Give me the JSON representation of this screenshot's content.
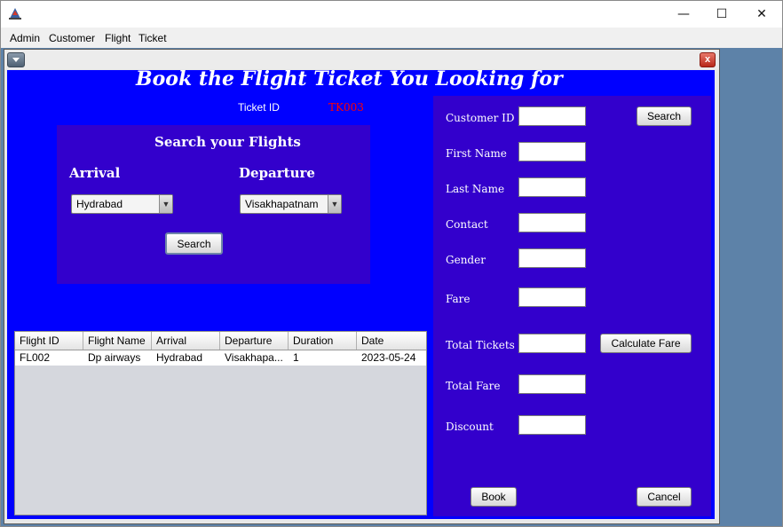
{
  "window": {
    "minimize": "—",
    "maximize": "☐",
    "close": "✕"
  },
  "menu": [
    "Admin",
    "Customer",
    "Flight",
    "Ticket"
  ],
  "frame": {
    "heading": "Book the Flight Ticket You Looking for",
    "ticket_id_label": "Ticket ID",
    "ticket_id_value": "TK003",
    "close_glyph": "x"
  },
  "search": {
    "title": "Search your Flights",
    "arrival_label": "Arrival",
    "departure_label": "Departure",
    "arrival_value": "Hydrabad",
    "departure_value": "Visakhapatnam",
    "button": "Search"
  },
  "table": {
    "columns": [
      "Flight ID",
      "Flight Name",
      "Arrival",
      "Departure",
      "Duration",
      "Date"
    ],
    "rows": [
      [
        "FL002",
        "Dp airways",
        "Hydrabad",
        "Visakhapa...",
        "1",
        "2023-05-24"
      ]
    ]
  },
  "customer": {
    "customer_id_label": "Customer ID",
    "first_name_label": "First Name",
    "last_name_label": "Last Name",
    "contact_label": "Contact",
    "gender_label": "Gender",
    "fare_label": "Fare",
    "total_tickets_label": "Total Tickets",
    "total_fare_label": "Total Fare",
    "discount_label": "Discount",
    "search_button": "Search",
    "calculate_button": "Calculate Fare",
    "book_button": "Book",
    "cancel_button": "Cancel",
    "customer_id_value": "",
    "first_name_value": "",
    "last_name_value": "",
    "contact_value": "",
    "gender_value": "",
    "fare_value": "",
    "total_tickets_value": "",
    "total_fare_value": "",
    "discount_value": ""
  },
  "colors": {
    "content_bg": "#0000ff",
    "panel_bg": "#3300cc",
    "ticket_id": "#ff0000"
  }
}
